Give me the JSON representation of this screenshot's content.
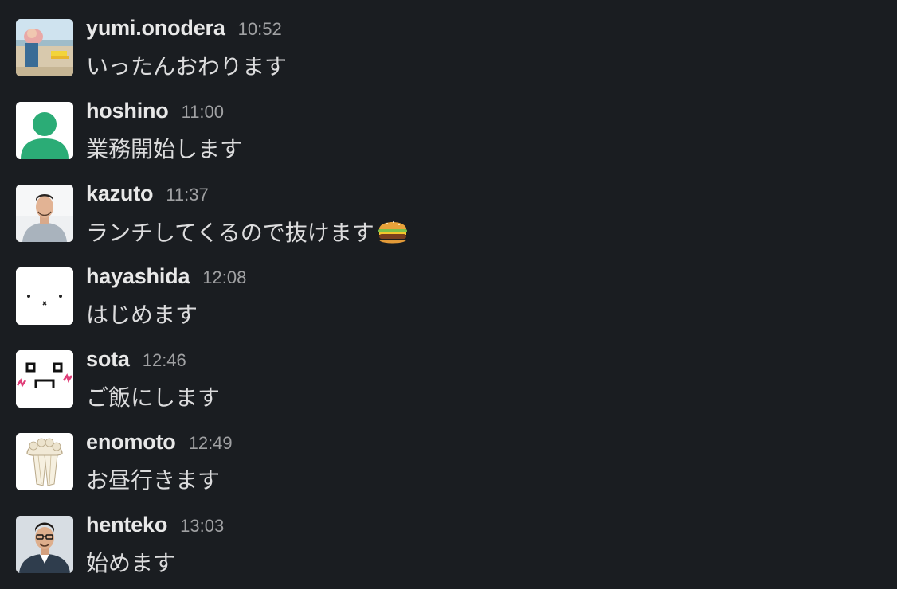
{
  "messages": [
    {
      "user": "yumi.onodera",
      "time": "10:52",
      "text": "いったんおわります",
      "avatar": "beach-photo-avatar"
    },
    {
      "user": "hoshino",
      "time": "11:00",
      "text": "業務開始します",
      "avatar": "default-person-avatar"
    },
    {
      "user": "kazuto",
      "time": "11:37",
      "text": "ランチしてくるので抜けます",
      "avatar": "portrait-photo-avatar",
      "emoji": "hamburger-emoji"
    },
    {
      "user": "hayashida",
      "time": "12:08",
      "text": "はじめます",
      "avatar": "simple-face-avatar"
    },
    {
      "user": "sota",
      "time": "12:46",
      "text": "ご飯にします",
      "avatar": "doodle-face-avatar"
    },
    {
      "user": "enomoto",
      "time": "12:49",
      "text": "お昼行きます",
      "avatar": "mushroom-avatar"
    },
    {
      "user": "henteko",
      "time": "13:03",
      "text": "始めます",
      "avatar": "portrait-photo-avatar"
    }
  ],
  "colors": {
    "background": "#1a1d21",
    "username": "#e8e8e8",
    "timestamp": "#a0a1a3",
    "message_text": "#dcdcdd",
    "default_avatar_green": "#2bac76"
  }
}
